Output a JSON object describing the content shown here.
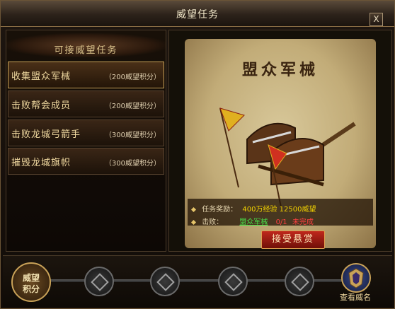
{
  "window": {
    "title": "威望任务",
    "close_label": "X"
  },
  "task_list": {
    "header": "可接威望任务",
    "items": [
      {
        "name": "收集盟众军械",
        "points": "（200威望积分）",
        "selected": true
      },
      {
        "name": "击败帮会成员",
        "points": "（200威望积分）",
        "selected": false
      },
      {
        "name": "击败龙城弓箭手",
        "points": "（300威望积分）",
        "selected": false
      },
      {
        "name": "摧毁龙城旗帜",
        "points": "（300威望积分）",
        "selected": false
      }
    ]
  },
  "detail": {
    "title": "盟众军械",
    "reward_label": "任务奖励：",
    "reward_value": "400万经验 12500威望",
    "defeat_label": "击败：",
    "defeat_target": "盟众军械",
    "defeat_progress": "0/1",
    "defeat_status": "未完成",
    "accept_label": "接受悬赏"
  },
  "bottom": {
    "reputation_label_1": "威望",
    "reputation_label_2": "积分",
    "rank_label": "查看威名"
  },
  "colors": {
    "accent_gold": "#c9a258",
    "button_red": "#c0281c",
    "reward_yellow": "#f0d000",
    "target_green": "#48e048"
  }
}
